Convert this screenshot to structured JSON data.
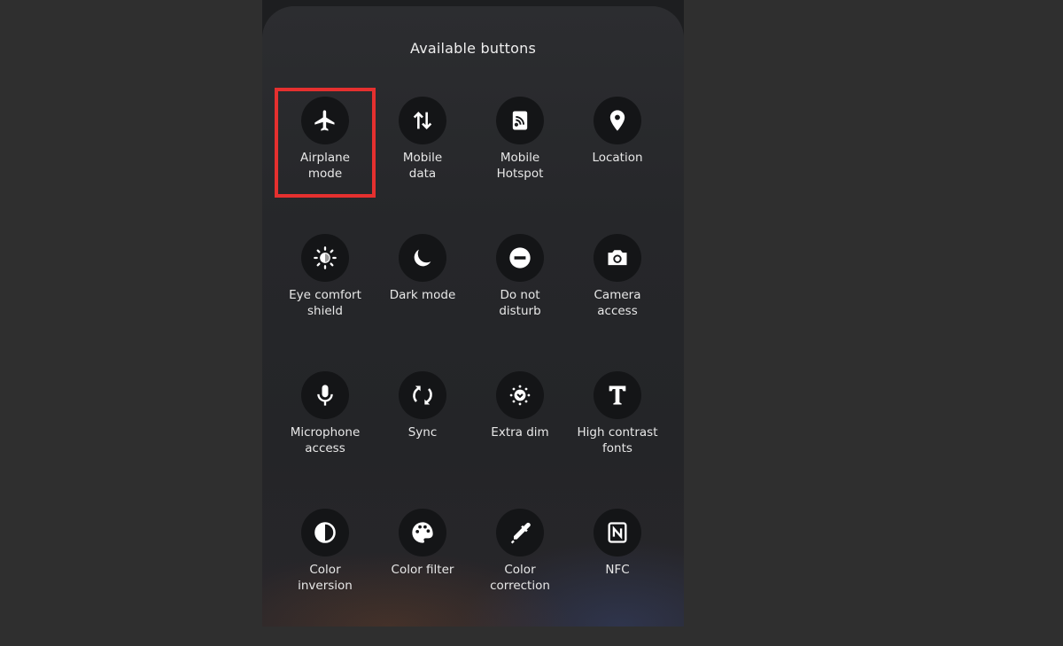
{
  "header": {
    "title": "Available buttons"
  },
  "buttons": [
    {
      "label": "Airplane\nmode",
      "icon": "airplane-icon",
      "highlighted": true
    },
    {
      "label": "Mobile\ndata",
      "icon": "mobile-data-icon"
    },
    {
      "label": "Mobile\nHotspot",
      "icon": "hotspot-icon"
    },
    {
      "label": "Location",
      "icon": "location-icon"
    },
    {
      "label": "Eye comfort\nshield",
      "icon": "eye-comfort-icon"
    },
    {
      "label": "Dark mode",
      "icon": "moon-icon"
    },
    {
      "label": "Do not\ndisturb",
      "icon": "do-not-disturb-icon"
    },
    {
      "label": "Camera\naccess",
      "icon": "camera-icon"
    },
    {
      "label": "Microphone\naccess",
      "icon": "microphone-icon"
    },
    {
      "label": "Sync",
      "icon": "sync-icon"
    },
    {
      "label": "Extra dim",
      "icon": "extra-dim-icon"
    },
    {
      "label": "High contrast\nfonts",
      "icon": "high-contrast-font-icon"
    },
    {
      "label": "Color\ninversion",
      "icon": "color-inversion-icon"
    },
    {
      "label": "Color filter",
      "icon": "palette-icon"
    },
    {
      "label": "Color\ncorrection",
      "icon": "eyedropper-icon"
    },
    {
      "label": "NFC",
      "icon": "nfc-icon"
    }
  ],
  "colors": {
    "highlight": "#e5302f",
    "icon": "#ffffff",
    "circle": "#141517"
  }
}
